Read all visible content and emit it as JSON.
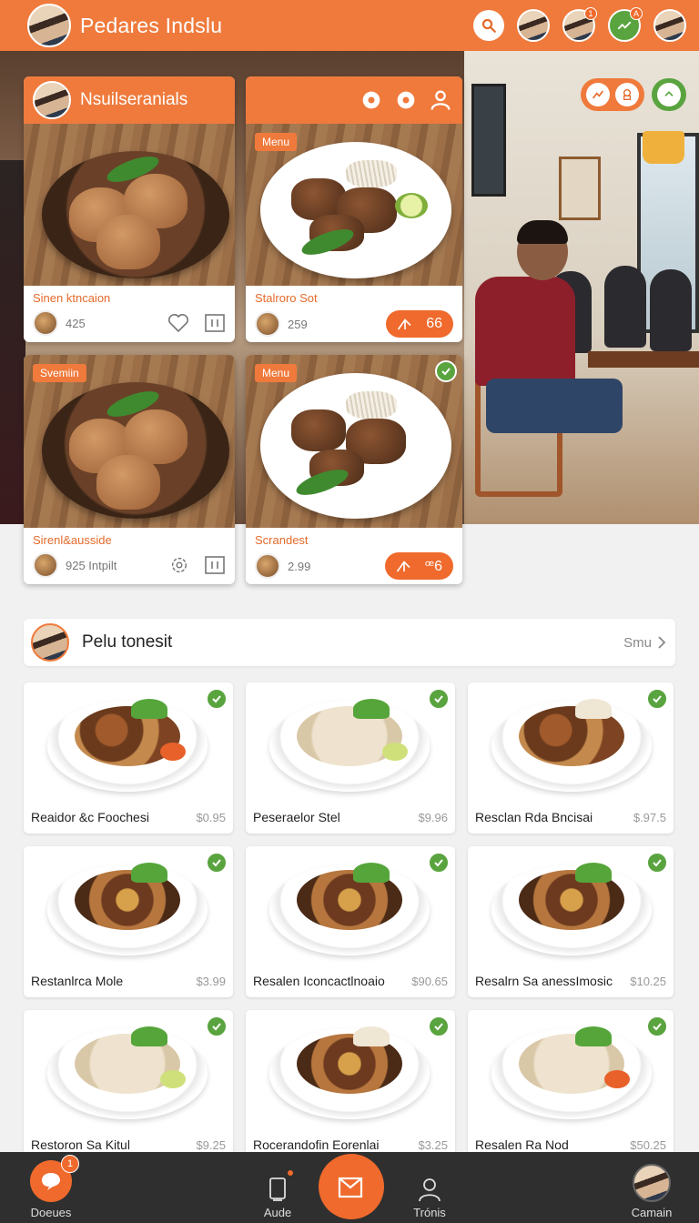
{
  "header": {
    "app_title": "Pedares Indslu",
    "badge_a": "1",
    "badge_b": "A"
  },
  "featured": [
    {
      "header_title": "Nsuilseranials",
      "tag": "",
      "title": "Sinen ktncaion",
      "value": "425",
      "order_label": ""
    },
    {
      "header_title": "",
      "tag": "Menu",
      "title": "Stalroro Sot",
      "value": "259",
      "order_label": "66"
    },
    {
      "header_title": "",
      "tag": "Svemiin",
      "title": "Sirenl&ausside",
      "value": "925 Intpilt",
      "order_label": ""
    },
    {
      "header_title": "",
      "tag": "Menu",
      "title": "Scrandest",
      "value": "2.99",
      "order_label": "ꟹ6"
    }
  ],
  "section": {
    "title": "Pelu tonesit",
    "more_label": "Smu"
  },
  "items": [
    {
      "name": "Reaidor &c Foochesi",
      "price": "$0.95"
    },
    {
      "name": "Peseraelor Stel",
      "price": "$9.96"
    },
    {
      "name": "Resclan Rda Bncisai",
      "price": "$.97.5"
    },
    {
      "name": "Restanlrca Mole",
      "price": "$3.99"
    },
    {
      "name": "Resalen Iconcactlnoaio",
      "price": "$90.65"
    },
    {
      "name": "Resalrn Sa anessImosic",
      "price": "$10.25"
    },
    {
      "name": "Restoron Sa Kitul",
      "price": "$9.25"
    },
    {
      "name": "Rocerandofin Eorenlai",
      "price": "$3.25"
    },
    {
      "name": "Resalen Ra Nod",
      "price": "$50.25"
    }
  ],
  "bottom_nav": {
    "home_label": "Doeues",
    "home_badge": "1",
    "add_label": "Aude",
    "profile_label": "Trónis",
    "account_label": "Camain"
  },
  "colors": {
    "accent": "#ef7a3c",
    "success": "#5aa43f",
    "nav_bg": "#2f2f2f"
  },
  "icons": [
    "search-icon",
    "settings-icon",
    "user-outline-icon",
    "heart-icon",
    "bookmark-icon",
    "check-icon",
    "chevron-right-icon",
    "chat-icon",
    "compose-icon",
    "person-icon",
    "trend-icon"
  ]
}
